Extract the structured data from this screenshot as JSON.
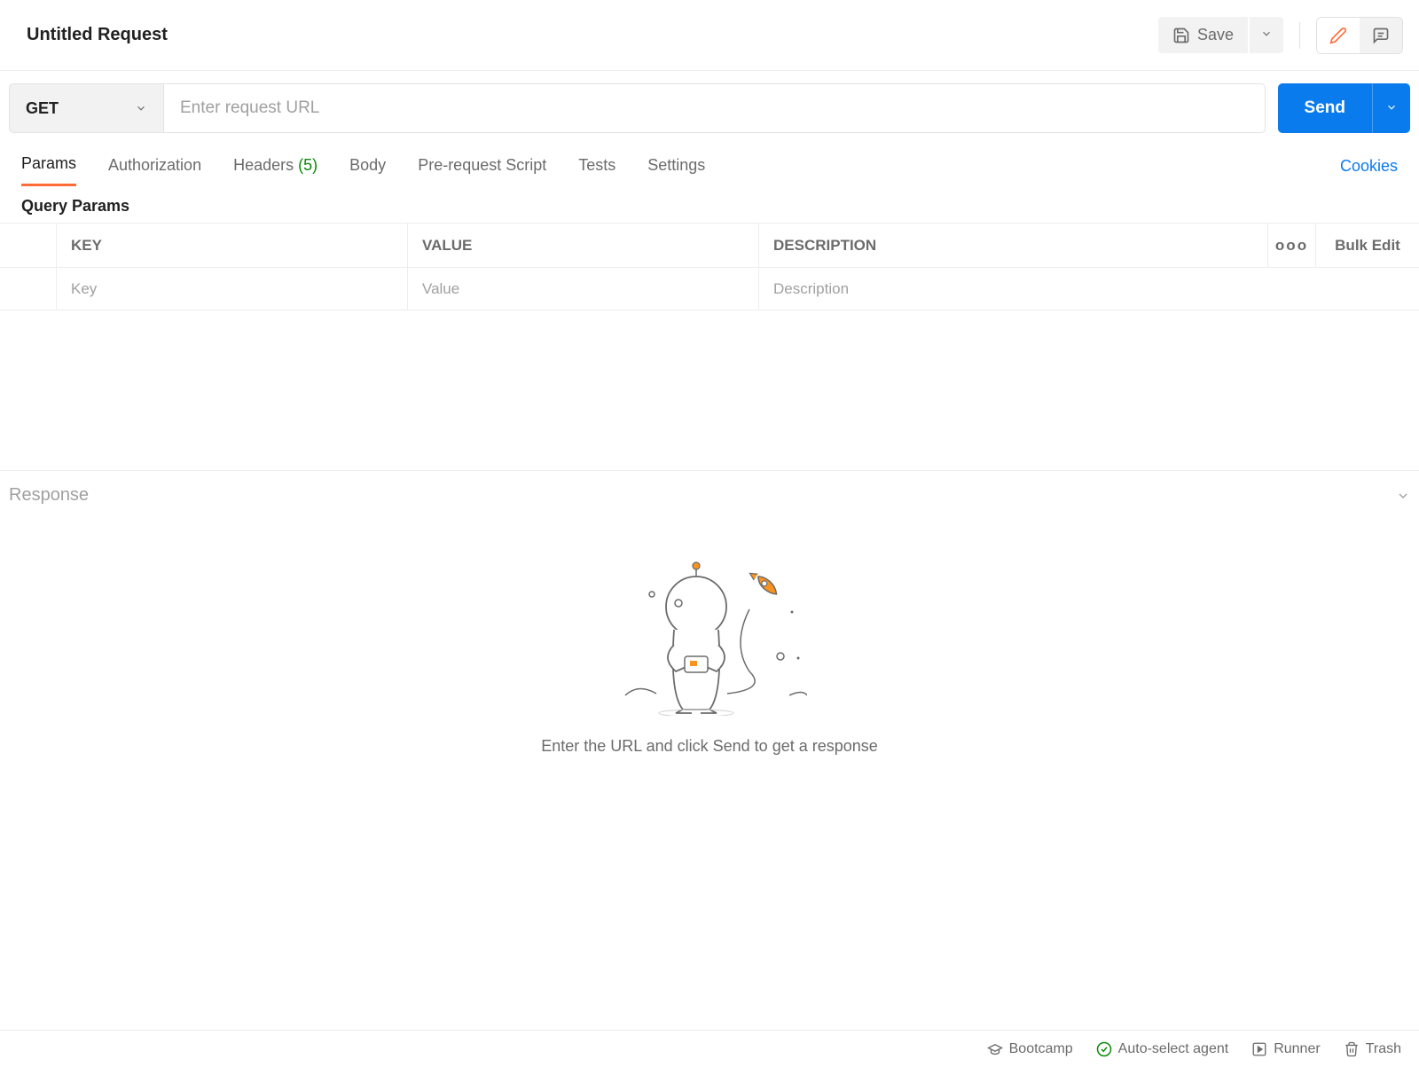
{
  "header": {
    "title": "Untitled Request",
    "save_label": "Save"
  },
  "request": {
    "method": "GET",
    "url_placeholder": "Enter request URL",
    "send_label": "Send"
  },
  "tabs": {
    "params": "Params",
    "authorization": "Authorization",
    "headers": "Headers",
    "headers_count": "(5)",
    "body": "Body",
    "pre_request": "Pre-request Script",
    "tests": "Tests",
    "settings": "Settings",
    "cookies": "Cookies"
  },
  "params_section": {
    "title": "Query Params",
    "col_key": "KEY",
    "col_value": "VALUE",
    "col_description": "DESCRIPTION",
    "bulk_edit": "Bulk Edit",
    "more": "ooo",
    "row": {
      "key_placeholder": "Key",
      "value_placeholder": "Value",
      "description_placeholder": "Description"
    }
  },
  "response": {
    "title": "Response",
    "empty_text": "Enter the URL and click Send to get a response"
  },
  "footer": {
    "bootcamp": "Bootcamp",
    "auto_select": "Auto-select agent",
    "runner": "Runner",
    "trash": "Trash"
  },
  "colors": {
    "accent": "#ff6c37",
    "primary": "#097bed"
  }
}
